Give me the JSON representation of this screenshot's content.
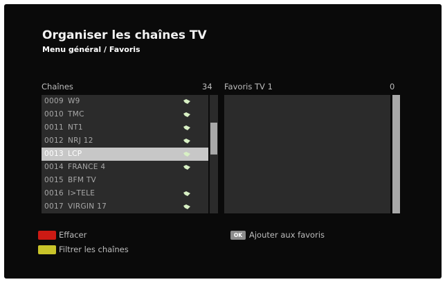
{
  "screen": {
    "title": "Organiser les chaînes TV",
    "subtitle": "Menu général / Favoris"
  },
  "channels_panel": {
    "label": "Chaînes",
    "count": "34",
    "rows": [
      {
        "number": "0009",
        "name": "W9",
        "favorite": true,
        "selected": false
      },
      {
        "number": "0010",
        "name": "TMC",
        "favorite": true,
        "selected": false
      },
      {
        "number": "0011",
        "name": "NT1",
        "favorite": true,
        "selected": false
      },
      {
        "number": "0012",
        "name": "NRJ 12",
        "favorite": true,
        "selected": false
      },
      {
        "number": "0013",
        "name": "LCP",
        "favorite": true,
        "selected": true
      },
      {
        "number": "0014",
        "name": "FRANCE 4",
        "favorite": true,
        "selected": false
      },
      {
        "number": "0015",
        "name": "BFM TV",
        "favorite": false,
        "selected": false
      },
      {
        "number": "0016",
        "name": "I>TELE",
        "favorite": true,
        "selected": false
      },
      {
        "number": "0017",
        "name": "VIRGIN 17",
        "favorite": true,
        "selected": false
      }
    ]
  },
  "favorites_panel": {
    "label": "Favoris TV 1",
    "count": "0"
  },
  "legend": {
    "red_label": "Effacer",
    "yellow_label": "Filtrer les chaînes",
    "ok_key": "OK",
    "ok_label": "Ajouter aux favoris"
  },
  "colors": {
    "red_key": "#cc1a14",
    "yellow_key": "#c9c42a",
    "fav_icon": "#d8f0c4"
  },
  "icons": {
    "favorite_marker": "diamond-arrow-icon"
  }
}
